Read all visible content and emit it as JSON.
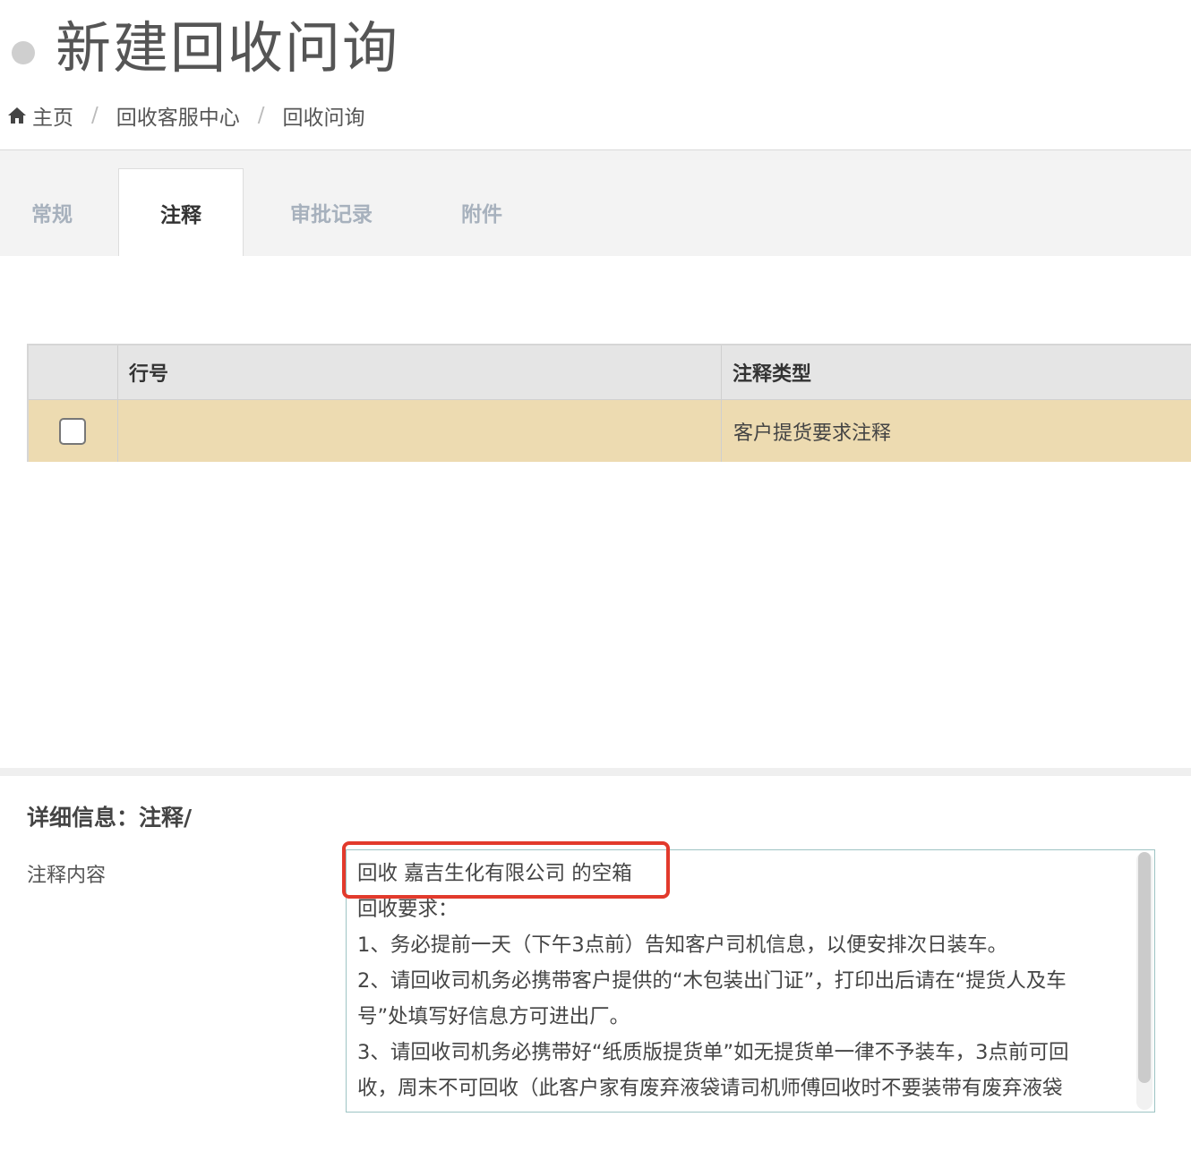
{
  "header": {
    "title": "新建回收问询"
  },
  "breadcrumb": {
    "items": [
      "主页",
      "回收客服中心",
      "回收问询"
    ],
    "separator": "/"
  },
  "tabs": [
    {
      "label": "常规",
      "active": false
    },
    {
      "label": "注释",
      "active": true
    },
    {
      "label": "审批记录",
      "active": false
    },
    {
      "label": "附件",
      "active": false
    }
  ],
  "grid": {
    "columns": [
      "行号",
      "注释类型"
    ],
    "rows": [
      {
        "checked": false,
        "line_no": "",
        "note_type": "客户提货要求注释"
      }
    ]
  },
  "detail": {
    "title": "详细信息：注释/",
    "field_label": "注释内容",
    "content_lines": [
      "回收 嘉吉生化有限公司 的空箱",
      "回收要求：",
      "1、务必提前一天（下午3点前）告知客户司机信息，以便安排次日装车。",
      "2、请回收司机务必携带客户提供的“木包装出门证”，打印出后请在“提货人及车",
      "号”处填写好信息方可进出厂。",
      "3、请回收司机务必携带好“纸质版提货单”如无提货单一律不予装车，3点前可回",
      "收，周末不可回收（此客户家有废弃液袋请司机师傅回收时不要装带有废弃液袋"
    ]
  },
  "colors": {
    "selected_row": "#eddbb1",
    "highlight_border": "#e23a2c",
    "tab_inactive": "#a7b1bd"
  }
}
